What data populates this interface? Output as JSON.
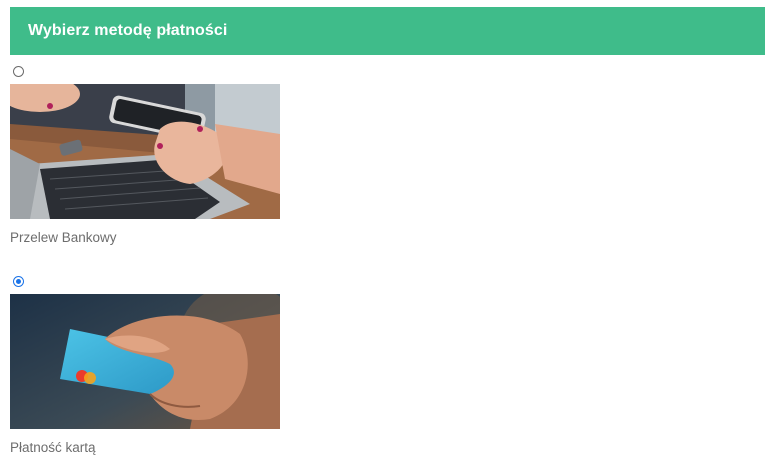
{
  "header": {
    "title": "Wybierz metodę płatności"
  },
  "payment_methods": [
    {
      "label": "Przelew Bankowy",
      "selected": false,
      "image": "laptop-and-phone-photo"
    },
    {
      "label": "Płatność kartą",
      "selected": true,
      "image": "credit-card-photo"
    }
  ],
  "colors": {
    "header_bg": "#3fbc8a",
    "header_text": "#ffffff",
    "label_text": "#6d6d6d",
    "radio_selected": "#1a73e8"
  }
}
